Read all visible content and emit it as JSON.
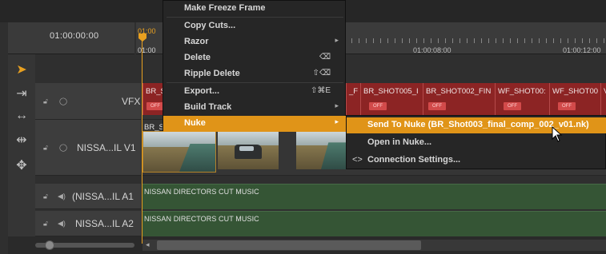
{
  "timeline": {
    "timecode": "01:00:00:00",
    "ruler": {
      "playhead_time": "01:00",
      "playhead_time2": "01:00",
      "labels": [
        "01:00:08:00",
        "01:00:12:00"
      ]
    }
  },
  "tracks": {
    "vfx": {
      "name": "VFX",
      "lock_icon": "lock-icon",
      "eye_icon": "eye-icon"
    },
    "v1": {
      "name": "NISSA...IL V1"
    },
    "a1": {
      "name": "(NISSA...IL A1",
      "clip_label": "NISSAN DIRECTORS CUT MUSIC"
    },
    "a2": {
      "name": "NISSA...IL A2",
      "clip_label": "NISSAN DIRECTORS CUT MUSIC"
    }
  },
  "vfx_clips": [
    {
      "name": "BR_S",
      "badge": "OFF"
    },
    {
      "name": "_F",
      "badge": ""
    },
    {
      "name": "BR_SHOT005_I",
      "badge": "OFF"
    },
    {
      "name": "BR_SHOT002_FIN",
      "badge": "OFF"
    },
    {
      "name": "WF_SHOT00:",
      "badge": "OFF"
    },
    {
      "name": "WF_SHOT00",
      "badge": "OFF"
    },
    {
      "name": "V",
      "badge": ""
    }
  ],
  "v1_first_clip_label": "BR_S",
  "context_menu": {
    "items": [
      {
        "label": "Make Freeze Frame",
        "shortcut": ""
      },
      {
        "label": "Copy Cuts...",
        "shortcut": ""
      },
      {
        "label": "Razor",
        "shortcut": ""
      },
      {
        "label": "Delete",
        "shortcut": "⌫"
      },
      {
        "label": "Ripple Delete",
        "shortcut": "⇧⌫"
      },
      {
        "label": "Export...",
        "shortcut": "⇧⌘E"
      },
      {
        "label": "Build Track",
        "shortcut": ""
      },
      {
        "label": "Nuke",
        "shortcut": ""
      }
    ]
  },
  "submenu": {
    "items": [
      {
        "label": "Send To Nuke (BR_Shot003_final_comp_002_v01.nk)"
      },
      {
        "label": "Open in Nuke..."
      },
      {
        "label": "Connection Settings..."
      }
    ]
  },
  "colors": {
    "accent": "#e09418",
    "vfx_clip": "#8c2424",
    "audio_track": "#355535"
  }
}
